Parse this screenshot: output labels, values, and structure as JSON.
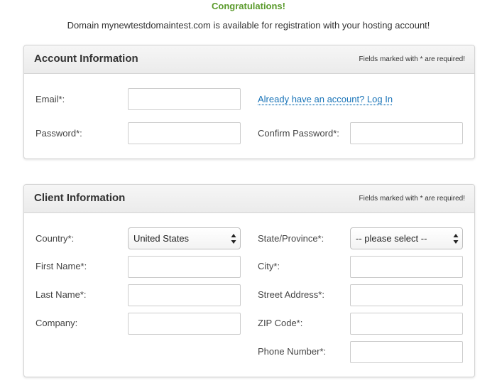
{
  "header": {
    "congrats": "Congratulations!",
    "availability": "Domain mynewtestdomaintest.com is available for registration with your hosting account!"
  },
  "account": {
    "title": "Account Information",
    "note": "Fields marked with * are required!",
    "email_label": "Email*:",
    "password_label": "Password*:",
    "confirm_password_label": "Confirm Password*:",
    "login_link": "Already have an account? Log In",
    "email_value": "",
    "password_value": "",
    "confirm_password_value": ""
  },
  "client": {
    "title": "Client Information",
    "note": "Fields marked with * are required!",
    "country_label": "Country*:",
    "country_value": "United States",
    "state_label": "State/Province*:",
    "state_value": "-- please select --",
    "first_name_label": "First Name*:",
    "last_name_label": "Last Name*:",
    "company_label": "Company:",
    "city_label": "City*:",
    "street_label": "Street Address*:",
    "zip_label": "ZIP Code*:",
    "phone_label": "Phone Number*:"
  },
  "colors": {
    "congrats_green": "#5a9a2b",
    "link_blue": "#1a74b8"
  },
  "icons": {
    "select_arrows": "updown-arrows-icon"
  }
}
